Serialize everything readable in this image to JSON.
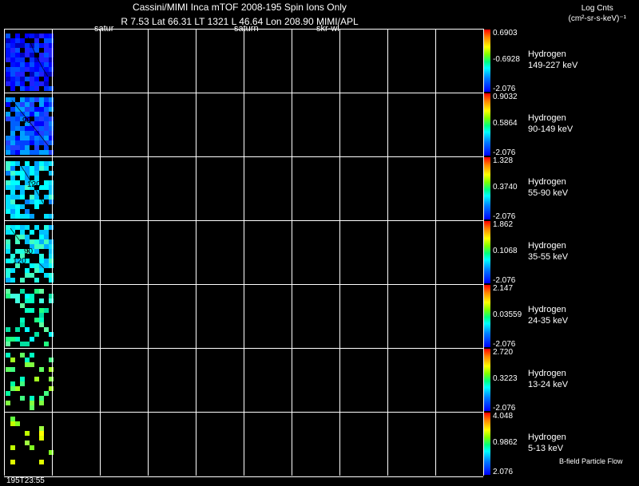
{
  "header": {
    "title": "Cassini/MIMI Inca mTOF  2008-195   Spin    Ions Only",
    "subtitle": "R        7.53 Lat 66.31 LT 1321 L         46.64 Lon          208.90  MIMI/APL",
    "overlay_labels": [
      "satur",
      "saturn",
      "skr-wl"
    ],
    "subtitle_prefix": "R"
  },
  "legend": {
    "title_line1": "Log Cnts",
    "title_line2": "(cm²-sr-s-keV)⁻¹"
  },
  "panels": [
    {
      "species": "Hydrogen",
      "energy": "149-227 keV",
      "max": "0.6903",
      "mid": "-0.6928",
      "min": "-2.076"
    },
    {
      "species": "Hydrogen",
      "energy": "90-149 keV",
      "max": "0.9032",
      "mid": "0.5864",
      "min": "-2.076"
    },
    {
      "species": "Hydrogen",
      "energy": "55-90 keV",
      "max": "1.328",
      "mid": "0.3740",
      "min": "-2.076"
    },
    {
      "species": "Hydrogen",
      "energy": "35-55 keV",
      "max": "1.862",
      "mid": "0.1068",
      "min": "-2.076"
    },
    {
      "species": "Hydrogen",
      "energy": "24-35 keV",
      "max": "2.147",
      "mid": "0.03559",
      "min": "-2.076"
    },
    {
      "species": "Hydrogen",
      "energy": "13-24 keV",
      "max": "2.720",
      "mid": "0.3223",
      "min": "-2.076"
    },
    {
      "species": "Hydrogen",
      "energy": "5-13 keV",
      "max": "4.048",
      "mid": "0.9862",
      "min": "2.076"
    }
  ],
  "contour_labels": [
    "90",
    "120",
    "90",
    "120"
  ],
  "footer": {
    "time": "195T23:55",
    "bfield_label": "B-field Particle Flow"
  },
  "colors": {
    "background": "#000000",
    "grid": "#ffffff"
  }
}
